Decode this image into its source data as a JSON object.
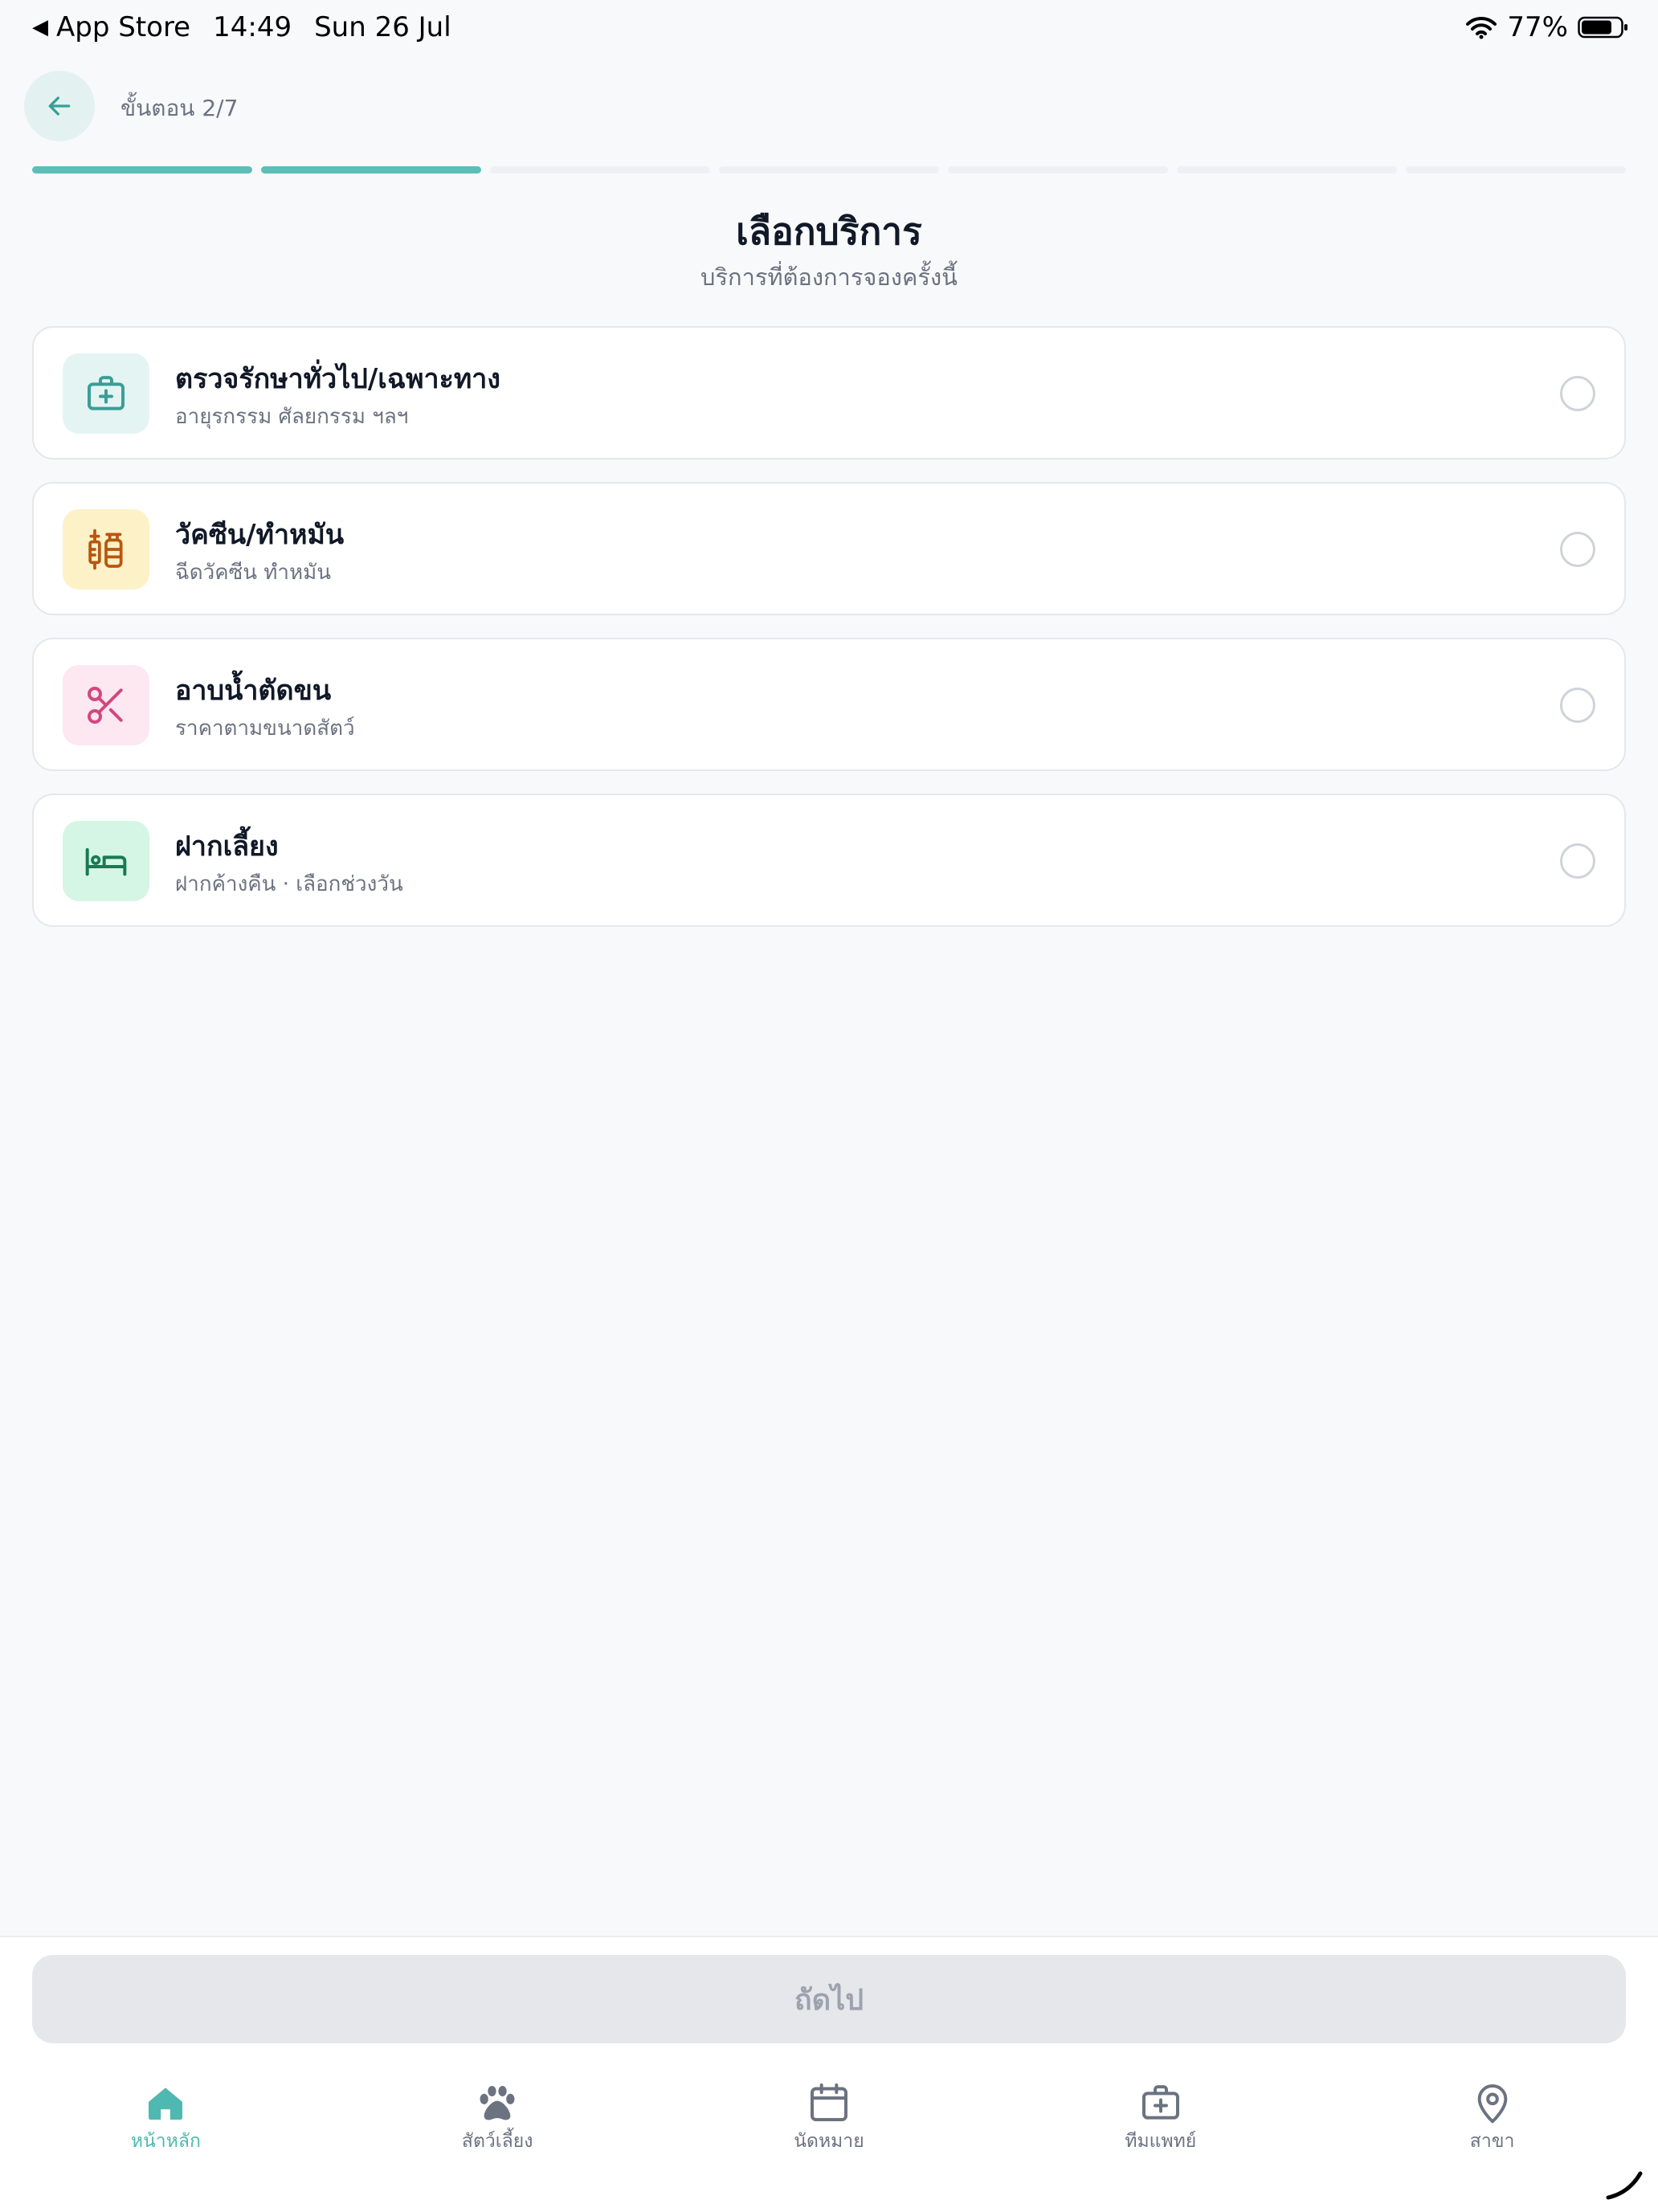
{
  "status_bar": {
    "back_app": "App Store",
    "time": "14:49",
    "date": "Sun 26 Jul",
    "battery": "77%"
  },
  "header": {
    "step": "ขั้นตอน 2/7",
    "total_steps": 7,
    "completed_steps": 2
  },
  "page": {
    "title": "เลือกบริการ",
    "subtitle": "บริการที่ต้องการจองครั้งนี้"
  },
  "services": [
    {
      "name": "ตรวจรักษาทั่วไป/เฉพาะทาง",
      "desc": "อายุรกรรม ศัลยกรรม ฯลฯ",
      "icon": "medical-kit-icon",
      "icon_color": "#3a9e97",
      "icon_bg": "#e4f4f2",
      "selected": false
    },
    {
      "name": "วัคซีน/ทำหมัน",
      "desc": "ฉีดวัคซีน ทำหมัน",
      "icon": "vaccine-icon",
      "icon_color": "#b8560f",
      "icon_bg": "#fdf1c8",
      "selected": false
    },
    {
      "name": "อาบน้ำตัดขน",
      "desc": "ราคาตามขนาดสัตว์",
      "icon": "scissors-icon",
      "icon_color": "#d3477e",
      "icon_bg": "#fde7f0",
      "selected": false
    },
    {
      "name": "ฝากเลี้ยง",
      "desc": "ฝากค้างคืน · เลือกช่วงวัน",
      "icon": "bed-icon",
      "icon_color": "#177a52",
      "icon_bg": "#d5f5e5",
      "selected": false
    }
  ],
  "next_button": "ถัดไป",
  "tabs": [
    {
      "label": "หน้าหลัก",
      "icon": "home-icon",
      "active": true
    },
    {
      "label": "สัตว์เลี้ยง",
      "icon": "paw-icon",
      "active": false
    },
    {
      "label": "นัดหมาย",
      "icon": "calendar-icon",
      "active": false
    },
    {
      "label": "ทีมแพทย์",
      "icon": "medical-bag-icon",
      "active": false
    },
    {
      "label": "สาขา",
      "icon": "location-pin-icon",
      "active": false
    }
  ],
  "colors": {
    "accent": "#5bbfb8",
    "tab_active": "#4fb8b0",
    "tab_inactive": "#6b7280",
    "background": "#f8f9fb"
  }
}
